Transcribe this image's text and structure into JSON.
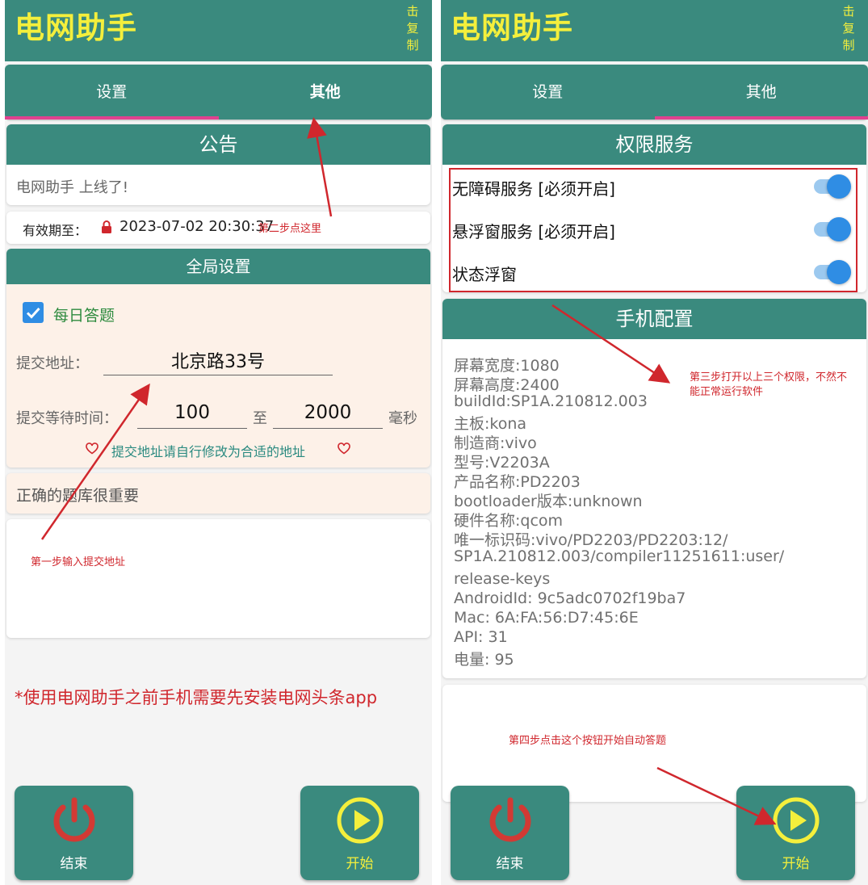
{
  "app": {
    "title": "电网助手",
    "copy_hint": "击复制"
  },
  "tabs": [
    "设置",
    "其他"
  ],
  "left": {
    "announcement": {
      "title": "公告",
      "text": "电网助手 上线了!"
    },
    "validity": {
      "label": "有效期至：",
      "date": "2023-07-02 20:30:37"
    },
    "global_settings": {
      "title": "全局设置",
      "daily_quiz_label": "每日答题",
      "daily_quiz_checked": true,
      "address_label": "提交地址：",
      "address_value": "北京路33号",
      "wait_label": "提交等待时间：",
      "wait_min": "100",
      "wait_to": "至",
      "wait_max": "2000",
      "wait_unit": "毫秒",
      "hint": "提交地址请自行修改为合适的地址"
    },
    "question_bank_text": "正确的题库很重要",
    "warning": "*使用电网助手之前手机需要先安装电网头条app"
  },
  "right": {
    "permissions": {
      "title": "权限服务",
      "items": [
        {
          "label": "无障碍服务 [必须开启]",
          "enabled": true
        },
        {
          "label": "悬浮窗服务 [必须开启]",
          "enabled": true
        },
        {
          "label": "状态浮窗",
          "enabled": true
        }
      ]
    },
    "phone_config": {
      "title": "手机配置",
      "lines": [
        "屏幕宽度:1080",
        "屏幕高度:2400",
        "buildId:SP1A.210812.003",
        "主板:kona",
        "制造商:vivo",
        "型号:V2203A",
        "产品名称:PD2203",
        "bootloader版本:unknown",
        "硬件名称:qcom",
        "唯一标识码:vivo/PD2203/PD2203:12/",
        "SP1A.210812.003/compiler11251611:user/",
        "release-keys",
        "AndroidId: 9c5adc0702f19ba7",
        "Mac: 6A:FA:56:D7:45:6E",
        "API: 31",
        "电量: 95"
      ]
    }
  },
  "buttons": {
    "end": "结束",
    "start": "开始"
  },
  "annotations": {
    "step1": "第一步输入提交地址",
    "step2": "第二步点这里",
    "step3_line1": "第三步打开以上三个权限，不然不",
    "step3_line2": "能正常运行软件",
    "step4": "第四步点击这个按钮开始自动答题"
  },
  "colors": {
    "primary": "#3a8a7e",
    "title_yellow": "#f4ef3c",
    "tab_indicator": "#e0418f",
    "switch_blue": "#2f8de4",
    "annotation_red": "#d0272d",
    "power_red": "#d23a34",
    "play_yellow": "#f4ef3c"
  }
}
